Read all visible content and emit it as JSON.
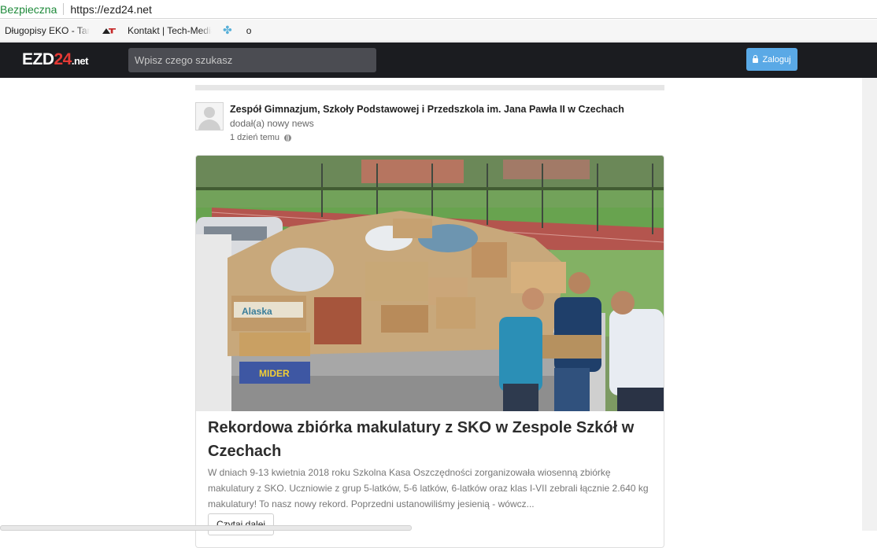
{
  "browser": {
    "security_label": "Bezpieczna",
    "url": "https://ezd24.net",
    "bookmarks": [
      {
        "label": "Długopisy EKO - Tam",
        "icon": "none"
      },
      {
        "label": "",
        "icon": "at-logo-icon"
      },
      {
        "label": "Kontakt | Tech-Media",
        "icon": "none"
      },
      {
        "label": "",
        "icon": "flower-icon"
      },
      {
        "label": "o",
        "icon": "none"
      }
    ]
  },
  "navbar": {
    "logo_main": "EZD",
    "logo_num": "24",
    "logo_suffix": ".net",
    "search_placeholder": "Wpisz czego szukasz",
    "login_label": "Zaloguj",
    "colors": {
      "bar": "#1b1c20",
      "login": "#5aa9e6",
      "logo_accent": "#e53935"
    }
  },
  "post": {
    "author": "Zespół Gimnazjum, Szkoły Podstawowej i Przedszkola im. Jana Pawła II w Czechach",
    "action": "dodał(a) nowy news",
    "time": "1 dzień temu",
    "article": {
      "title": "Rekordowa zbiórka makulatury z SKO w Zespole Szkół w Czechach",
      "excerpt": "W dniach 9-13 kwietnia 2018 roku Szkolna Kasa Oszczędności zorganizowała wiosenną zbiórkę makulatury z SKO. Uczniowie z grup 5-latków, 5-6 latków, 6-latków oraz klas I-VII zebrali łącznie 2.640 kg makulatury! To nasz nowy rekord. Poprzedni ustanowiliśmy jesienią - wówcz...",
      "read_more": "Czytaj dalej",
      "photo_box_labels": [
        "Alaska",
        "MIDER"
      ]
    }
  }
}
